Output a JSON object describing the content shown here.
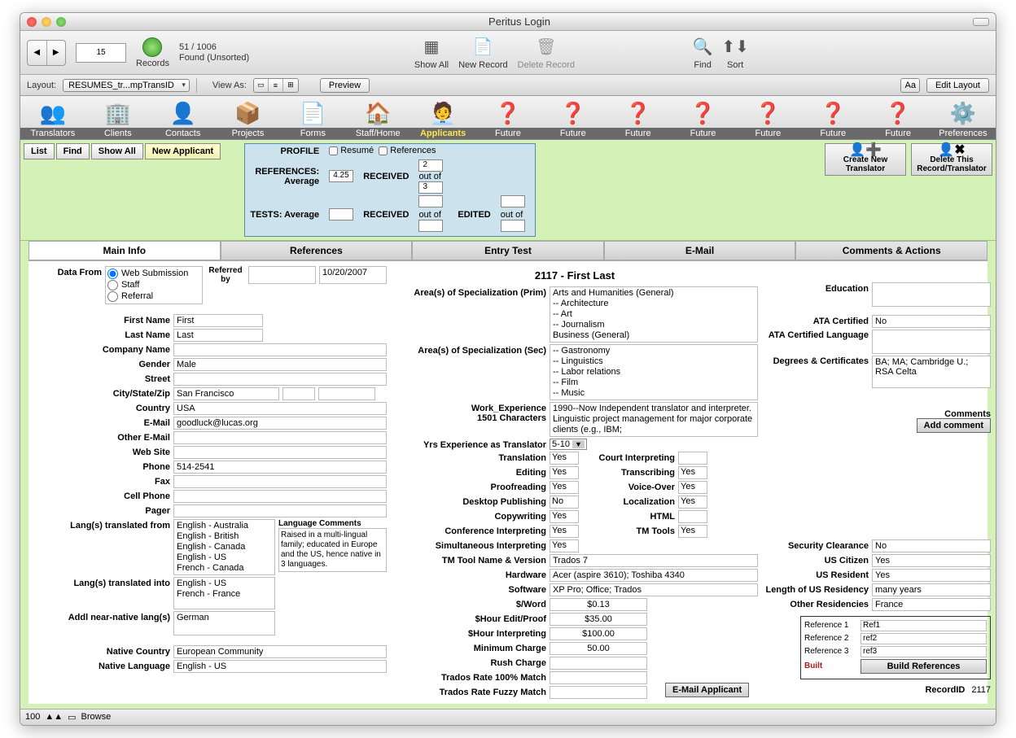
{
  "window": {
    "title": "Peritus Login"
  },
  "toolbar1": {
    "record_pos": "15",
    "found_count": "51 / 1006",
    "found_status": "Found (Unsorted)",
    "records_label": "Records",
    "show_all": "Show All",
    "new_record": "New Record",
    "delete_record": "Delete Record",
    "find": "Find",
    "sort": "Sort"
  },
  "toolbar2": {
    "layout_label": "Layout:",
    "layout_value": "RESUMES_tr...mpTransID",
    "view_as": "View As:",
    "preview": "Preview",
    "edit_layout": "Edit Layout"
  },
  "navbar": {
    "items": [
      "Translators",
      "Clients",
      "Contacts",
      "Projects",
      "Forms",
      "Staff/Home",
      "Applicants",
      "Future",
      "Future",
      "Future",
      "Future",
      "Future",
      "Future",
      "Future",
      "Preferences"
    ],
    "active_index": 6
  },
  "action_buttons": {
    "list": "List",
    "find": "Find",
    "show_all": "Show All",
    "new_applicant": "New Applicant"
  },
  "profile_box": {
    "profile": "PROFILE",
    "resume": "Resumé",
    "references": "References",
    "references_avg_label": "REFERENCES: Average",
    "references_avg": "4.25",
    "tests_avg_label": "TESTS: Average",
    "tests_avg": "",
    "received1_label": "RECEIVED",
    "received1": "2",
    "outof1": "out of",
    "outof1_v": "3",
    "received2_label": "RECEIVED",
    "received2": "",
    "outof2": "out of",
    "outof2_v": "",
    "edited_label": "EDITED",
    "edited": "",
    "outof3": "out of",
    "outof3_v": ""
  },
  "big_buttons": {
    "create": "Create New\nTranslator",
    "delete": "Delete This\nRecord/Translator"
  },
  "tabs": [
    "Main Info",
    "References",
    "Entry Test",
    "E-Mail",
    "Comments & Actions"
  ],
  "record_title": "2117 - First Last",
  "main": {
    "data_from_label": "Data From",
    "data_from_options": [
      "Web Submission",
      "Staff",
      "Referral"
    ],
    "data_from_selected": "Web Submission",
    "referred_by_label": "Referred by",
    "referred_by": "",
    "referred_date": "10/20/2007",
    "first_name_label": "First Name",
    "first_name": "First",
    "last_name_label": "Last Name",
    "last_name": "Last",
    "company_label": "Company Name",
    "company": "",
    "gender_label": "Gender",
    "gender": "Male",
    "street_label": "Street",
    "street": "",
    "csz_label": "City/State/Zip",
    "city": "San Francisco",
    "state": "",
    "zip": "",
    "country_label": "Country",
    "country": "USA",
    "email_label": "E-Mail",
    "email": "goodluck@lucas.org",
    "other_email_label": "Other E-Mail",
    "other_email": "",
    "website_label": "Web Site",
    "website": "",
    "phone_label": "Phone",
    "phone": "514-2541",
    "fax_label": "Fax",
    "fax": "",
    "cell_label": "Cell Phone",
    "cell": "",
    "pager_label": "Pager",
    "pager": "",
    "langs_from_label": "Lang(s) translated from",
    "langs_from": "English - Australia\nEnglish - British\nEnglish - Canada\nEnglish - US\nFrench - Canada",
    "langs_into_label": "Lang(s) translated into",
    "langs_into": "English - US\nFrench - France",
    "addl_label": "Addl near-native lang(s)",
    "addl": "German",
    "native_country_label": "Native Country",
    "native_country": "European Community",
    "native_lang_label": "Native Language",
    "native_lang": "English - US",
    "lang_comments_label": "Language Comments",
    "lang_comments": "Raised in a multi-lingual family; educated in Europe and the US, hence native in 3 languages."
  },
  "col2": {
    "spec_prim_label": "Area(s) of Specialization (Prim)",
    "spec_prim": "Arts and Humanities (General)\n-- Architecture\n-- Art\n-- Journalism\nBusiness (General)",
    "spec_sec_label": "Area(s) of Specialization (Sec)",
    "spec_sec": "-- Gastronomy\n-- Linguistics\n-- Labor relations\n-- Film\n-- Music",
    "work_exp_label": "Work_Experience\n1501 Characters",
    "work_exp": "1990--Now   Independent translator and interpreter. Linguistic project management for major corporate clients (e.g., IBM;",
    "yrs_label": "Yrs Experience as Translator",
    "yrs": "5-10",
    "skills": {
      "translation": "Yes",
      "court_interp": "",
      "editing": "Yes",
      "transcribing": "Yes",
      "proofreading": "Yes",
      "voiceover": "Yes",
      "dtp": "No",
      "localization": "Yes",
      "copywriting": "Yes",
      "html": "",
      "conf_interp": "Yes",
      "tm_tools": "Yes",
      "sim_interp": "Yes"
    },
    "skill_labels": {
      "translation": "Translation",
      "court_interp": "Court Interpreting",
      "editing": "Editing",
      "transcribing": "Transcribing",
      "proofreading": "Proofreading",
      "voiceover": "Voice-Over",
      "dtp": "Desktop Publishing",
      "localization": "Localization",
      "copywriting": "Copywriting",
      "html": "HTML",
      "conf_interp": "Conference Interpreting",
      "tm_tools": "TM Tools",
      "sim_interp": "Simultaneous Interpreting"
    },
    "tm_tool_label": "TM Tool Name & Version",
    "tm_tool": "Trados 7",
    "hardware_label": "Hardware",
    "hardware": "Acer (aspire 3610); Toshiba 4340",
    "software_label": "Software",
    "software": "XP Pro; Office; Trados",
    "per_word_label": "$/Word",
    "per_word": "$0.13",
    "hr_edit_label": "$Hour Edit/Proof",
    "hr_edit": "$35.00",
    "hr_interp_label": "$Hour Interpreting",
    "hr_interp": "$100.00",
    "min_charge_label": "Minimum Charge",
    "min_charge": "50.00",
    "rush_label": "Rush Charge",
    "rush": "",
    "trados100_label": "Trados Rate 100% Match",
    "trados100": "",
    "tradosF_label": "Trados Rate Fuzzy Match",
    "tradosF": ""
  },
  "col3": {
    "education_label": "Education",
    "education": "",
    "ata_cert_label": "ATA Certified",
    "ata_cert": "No",
    "ata_lang_label": "ATA Certified Language",
    "ata_lang": "",
    "degrees_label": "Degrees & Certificates",
    "degrees": "BA; MA; Cambridge U.; RSA Celta",
    "comments_label": "Comments",
    "add_comment": "Add comment",
    "sec_clear_label": "Security Clearance",
    "sec_clear": "No",
    "us_cit_label": "US Citizen",
    "us_cit": "Yes",
    "us_res_label": "US Resident",
    "us_res": "Yes",
    "len_res_label": "Length of US Residency",
    "len_res": "many years",
    "other_res_label": "Other Residencies",
    "other_res": "France",
    "email_applicant": "E-Mail Applicant",
    "ref1_label": "Reference 1",
    "ref1": "Ref1",
    "ref2_label": "Reference 2",
    "ref2": "ref2",
    "ref3_label": "Reference 3",
    "ref3": "ref3",
    "built": "Built",
    "build_refs": "Build References",
    "record_id_label": "RecordID",
    "record_id": "2117"
  },
  "footer": {
    "zoom": "100",
    "mode": "Browse"
  }
}
